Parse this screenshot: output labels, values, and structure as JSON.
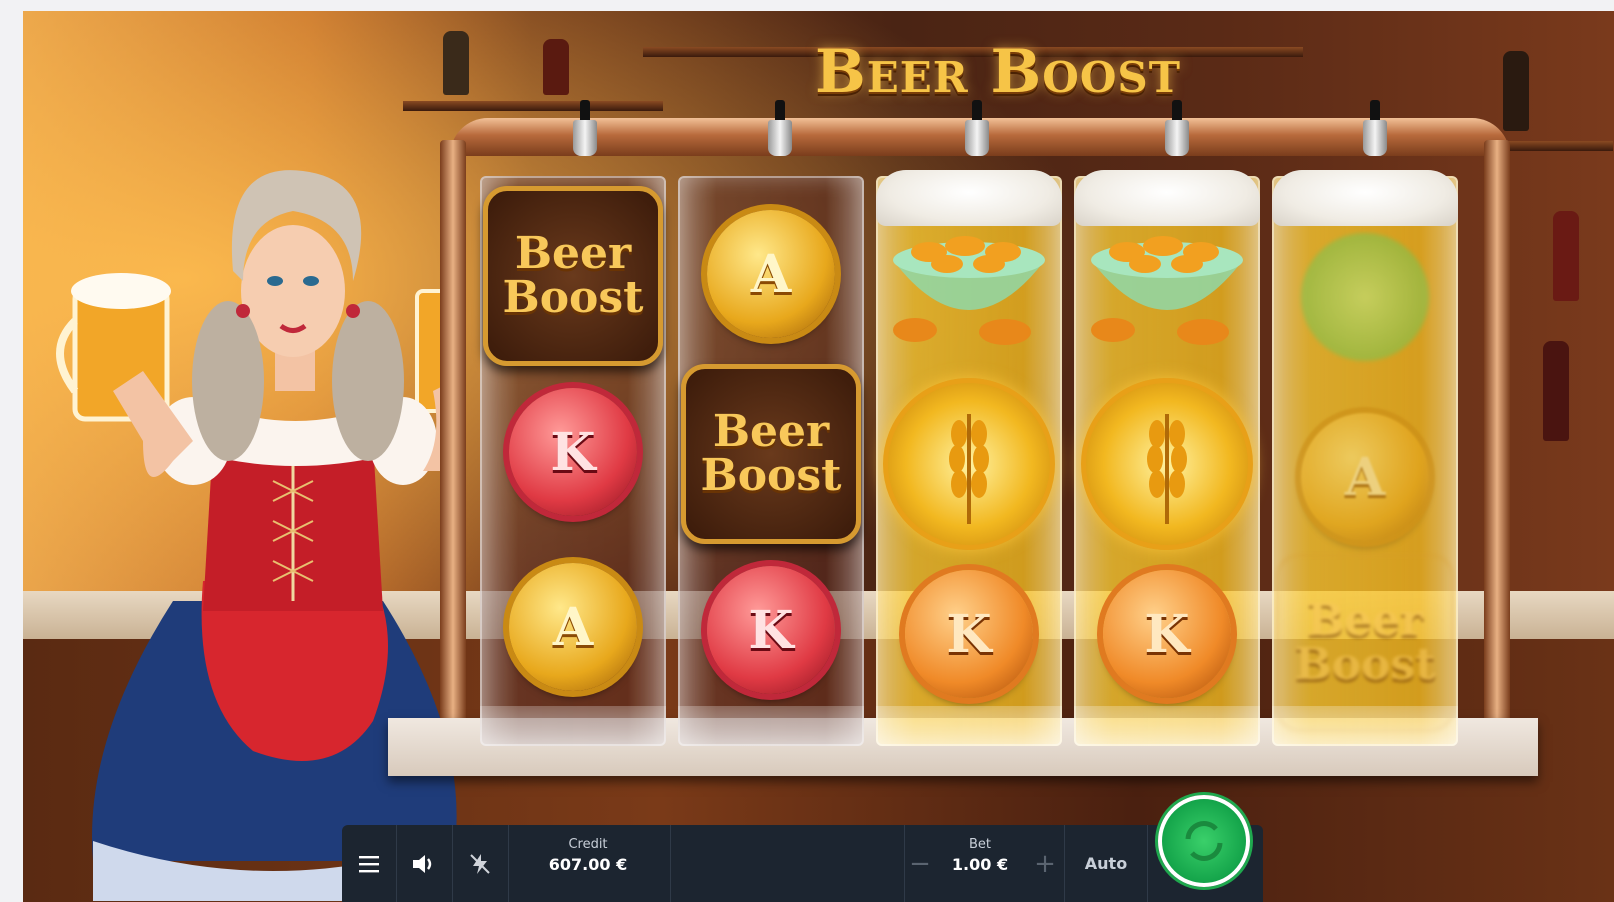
{
  "game": {
    "title": "Beer Boost",
    "reels": [
      {
        "state": "empty",
        "symbols": [
          "beer-boost-logo",
          "K",
          "A"
        ]
      },
      {
        "state": "empty",
        "symbols": [
          "A",
          "beer-boost-logo",
          "K"
        ]
      },
      {
        "state": "filled",
        "symbols": [
          "peanut-bowl",
          "wheat",
          "K"
        ]
      },
      {
        "state": "filled",
        "symbols": [
          "peanut-bowl",
          "wheat",
          "K"
        ]
      },
      {
        "state": "filled",
        "symbols": [
          "green-cap",
          "A",
          "beer-boost-logo"
        ]
      }
    ],
    "logo_symbol_text": [
      "Beer",
      "Boost"
    ],
    "symbol_letters": {
      "A": "A",
      "K": "K"
    }
  },
  "controls": {
    "menu_icon": "hamburger-menu-icon",
    "sound_icon": "speaker-icon",
    "turbo_icon": "lightning-icon",
    "credit_label": "Credit",
    "credit_value": "607.00 €",
    "bet_label": "Bet",
    "bet_value": "1.00 €",
    "bet_minus": "−",
    "bet_plus": "+",
    "auto_label": "Auto",
    "spin_icon": "spin-arrows-icon"
  },
  "colors": {
    "bar_bg": "#1c2530",
    "spin_green": "#1fa84e",
    "title_gold": "#f6c447"
  }
}
